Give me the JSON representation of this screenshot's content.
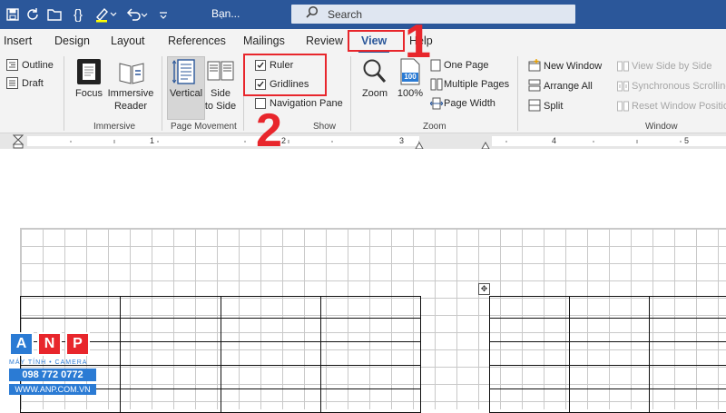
{
  "titlebar": {
    "doc_name": "Bạn...",
    "search_label": "Search"
  },
  "tabs": [
    {
      "label": "Insert"
    },
    {
      "label": "Design"
    },
    {
      "label": "Layout"
    },
    {
      "label": "References"
    },
    {
      "label": "Mailings"
    },
    {
      "label": "Review"
    },
    {
      "label": "View",
      "active": true
    },
    {
      "label": "Help"
    }
  ],
  "ribbon": {
    "views": {
      "outline": "Outline",
      "draft": "Draft"
    },
    "immersive": {
      "focus": "Focus",
      "reader_line1": "Immersive",
      "reader_line2": "Reader",
      "group": "Immersive"
    },
    "page_movement": {
      "vertical": "Vertical",
      "side_line1": "Side",
      "side_line2": "to Side",
      "group": "Page Movement"
    },
    "show": {
      "ruler": "Ruler",
      "gridlines": "Gridlines",
      "navigation_pane": "Navigation Pane",
      "group": "Show",
      "ruler_checked": true,
      "gridlines_checked": true,
      "navigation_pane_checked": false
    },
    "zoom": {
      "zoom": "Zoom",
      "percent": "100%",
      "percent_icon": "100",
      "one_page": "One Page",
      "multiple_pages": "Multiple Pages",
      "page_width": "Page Width",
      "group": "Zoom"
    },
    "window": {
      "new_window": "New Window",
      "arrange_all": "Arrange All",
      "split": "Split",
      "view_side_by_side": "View Side by Side",
      "synchronous_scrolling": "Synchronous Scrolling",
      "reset_window_position": "Reset Window Position",
      "group": "Window"
    }
  },
  "ruler": {
    "numbers": [
      "1",
      "2",
      "3",
      "4",
      "5"
    ]
  },
  "annotations": {
    "step1": "1",
    "step2": "2"
  },
  "watermark": {
    "letters": [
      "A",
      "N",
      "P"
    ],
    "subtitle": "MÁY TÍNH • CAMERA",
    "phone": "098 772 0772",
    "website": "WWW.ANP.COM.VN"
  },
  "colors": {
    "word_blue": "#2b579a",
    "annotation_red": "#e8262c",
    "ribbon_bg": "#f3f3f3"
  }
}
